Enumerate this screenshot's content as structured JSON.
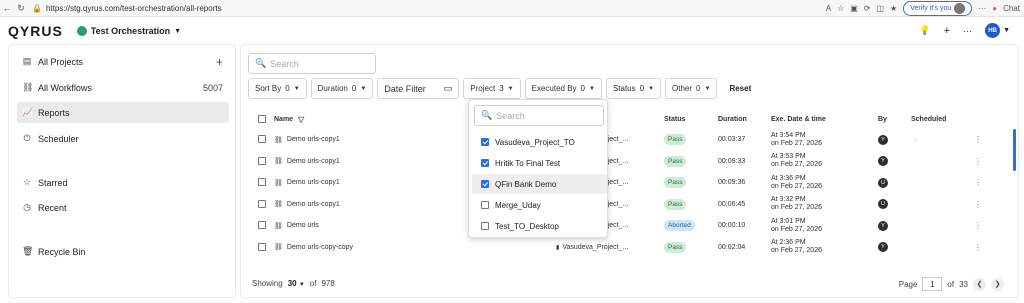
{
  "browser": {
    "url": "https://stg.qyrus.com/test-orchestration/all-reports",
    "verify_label": "Verify it's you",
    "chat_label": "Chat"
  },
  "app": {
    "logo": "QYRUS",
    "project": "Test Orchestration",
    "user_initials": "HB"
  },
  "sidebar": {
    "items": [
      {
        "label": "All Projects",
        "icon": "grid-icon",
        "extra": "+"
      },
      {
        "label": "All Workflows",
        "icon": "workflow-icon",
        "extra": "5007"
      },
      {
        "label": "Reports",
        "icon": "chart-icon",
        "extra": ""
      },
      {
        "label": "Scheduler",
        "icon": "clock-icon",
        "extra": ""
      },
      {
        "label": "Starred",
        "icon": "star-icon",
        "extra": ""
      },
      {
        "label": "Recent",
        "icon": "history-icon",
        "extra": ""
      },
      {
        "label": "Recycle Bin",
        "icon": "trash-icon",
        "extra": ""
      }
    ]
  },
  "search": {
    "placeholder": "Search"
  },
  "filters": [
    {
      "label": "Sort By",
      "count": "0"
    },
    {
      "label": "Duration",
      "count": "0"
    },
    {
      "label": "Date Filter",
      "count": ""
    },
    {
      "label": "Project",
      "count": "3"
    },
    {
      "label": "Executed By",
      "count": "0"
    },
    {
      "label": "Status",
      "count": "0"
    },
    {
      "label": "Other",
      "count": "0"
    }
  ],
  "reset_label": "Reset",
  "table": {
    "headers": {
      "name": "Name",
      "status": "Status",
      "duration": "Duration",
      "exe": "Exe. Date & time",
      "by": "By",
      "scheduled": "Scheduled"
    },
    "rows": [
      {
        "name": "Demo urls-copy1",
        "project": "Vasudeva_Project_...",
        "status": "Pass",
        "duration": "00:03:37",
        "time": "At 3:54 PM",
        "date": "on Feb 27, 2026",
        "by": "Y"
      },
      {
        "name": "Demo urls-copy1",
        "project": "Vasudeva_Project_...",
        "status": "Pass",
        "duration": "00:09:33",
        "time": "At 3:53 PM",
        "date": "on Feb 27, 2026",
        "by": "Y"
      },
      {
        "name": "Demo urls-copy1",
        "project": "Vasudeva_Project_...",
        "status": "Pass",
        "duration": "00:09:36",
        "time": "At 3:36 PM",
        "date": "on Feb 27, 2026",
        "by": "U"
      },
      {
        "name": "Demo urls-copy1",
        "project": "Vasudeva_Project_...",
        "status": "Pass",
        "duration": "00:06:45",
        "time": "At 3:32 PM",
        "date": "on Feb 27, 2026",
        "by": "U"
      },
      {
        "name": "Demo urls",
        "project": "Vasudeva_Project_...",
        "status": "Aborted",
        "duration": "00:00:10",
        "time": "At 3:01 PM",
        "date": "on Feb 27, 2026",
        "by": "Y"
      },
      {
        "name": "Demo urls-copy-copy",
        "project": "Vasudeva_Project_...",
        "status": "Pass",
        "duration": "00:02:04",
        "time": "At 2:36 PM",
        "date": "on Feb 27, 2026",
        "by": "Y"
      }
    ]
  },
  "footer": {
    "showing_label": "Showing",
    "page_size": "30",
    "of_label": "of",
    "total": "978"
  },
  "pager": {
    "page_label": "Page",
    "page": "1",
    "of_label": "of",
    "total_pages": "33"
  },
  "project_dropdown": {
    "search_placeholder": "Search",
    "options": [
      {
        "label": "Vasudeva_Project_TO",
        "checked": true
      },
      {
        "label": "Hritik To Final Test",
        "checked": true
      },
      {
        "label": "QFin Bank Demo",
        "checked": true
      },
      {
        "label": "Merge_Uday",
        "checked": false
      },
      {
        "label": "Test_TO_Desktop",
        "checked": false
      }
    ]
  },
  "colors": {
    "accent": "#2a6fdc",
    "pass": "#cdebd6",
    "aborted": "#cfe3f5"
  }
}
